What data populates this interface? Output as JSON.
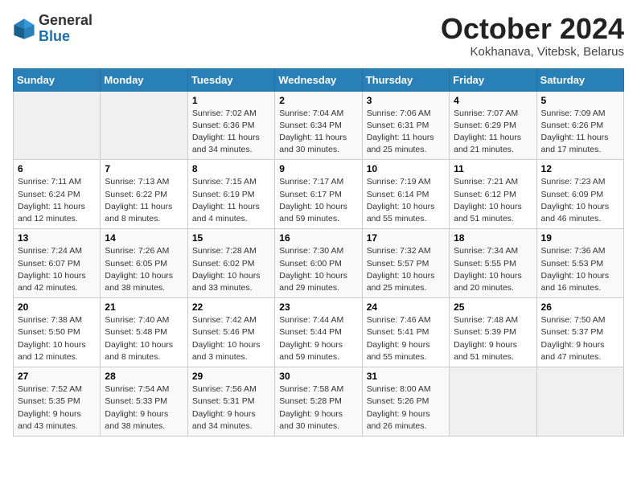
{
  "logo": {
    "general": "General",
    "blue": "Blue"
  },
  "header": {
    "month": "October 2024",
    "location": "Kokhanava, Vitebsk, Belarus"
  },
  "weekdays": [
    "Sunday",
    "Monday",
    "Tuesday",
    "Wednesday",
    "Thursday",
    "Friday",
    "Saturday"
  ],
  "weeks": [
    [
      {
        "day": "",
        "info": ""
      },
      {
        "day": "",
        "info": ""
      },
      {
        "day": "1",
        "info": "Sunrise: 7:02 AM\nSunset: 6:36 PM\nDaylight: 11 hours\nand 34 minutes."
      },
      {
        "day": "2",
        "info": "Sunrise: 7:04 AM\nSunset: 6:34 PM\nDaylight: 11 hours\nand 30 minutes."
      },
      {
        "day": "3",
        "info": "Sunrise: 7:06 AM\nSunset: 6:31 PM\nDaylight: 11 hours\nand 25 minutes."
      },
      {
        "day": "4",
        "info": "Sunrise: 7:07 AM\nSunset: 6:29 PM\nDaylight: 11 hours\nand 21 minutes."
      },
      {
        "day": "5",
        "info": "Sunrise: 7:09 AM\nSunset: 6:26 PM\nDaylight: 11 hours\nand 17 minutes."
      }
    ],
    [
      {
        "day": "6",
        "info": "Sunrise: 7:11 AM\nSunset: 6:24 PM\nDaylight: 11 hours\nand 12 minutes."
      },
      {
        "day": "7",
        "info": "Sunrise: 7:13 AM\nSunset: 6:22 PM\nDaylight: 11 hours\nand 8 minutes."
      },
      {
        "day": "8",
        "info": "Sunrise: 7:15 AM\nSunset: 6:19 PM\nDaylight: 11 hours\nand 4 minutes."
      },
      {
        "day": "9",
        "info": "Sunrise: 7:17 AM\nSunset: 6:17 PM\nDaylight: 10 hours\nand 59 minutes."
      },
      {
        "day": "10",
        "info": "Sunrise: 7:19 AM\nSunset: 6:14 PM\nDaylight: 10 hours\nand 55 minutes."
      },
      {
        "day": "11",
        "info": "Sunrise: 7:21 AM\nSunset: 6:12 PM\nDaylight: 10 hours\nand 51 minutes."
      },
      {
        "day": "12",
        "info": "Sunrise: 7:23 AM\nSunset: 6:09 PM\nDaylight: 10 hours\nand 46 minutes."
      }
    ],
    [
      {
        "day": "13",
        "info": "Sunrise: 7:24 AM\nSunset: 6:07 PM\nDaylight: 10 hours\nand 42 minutes."
      },
      {
        "day": "14",
        "info": "Sunrise: 7:26 AM\nSunset: 6:05 PM\nDaylight: 10 hours\nand 38 minutes."
      },
      {
        "day": "15",
        "info": "Sunrise: 7:28 AM\nSunset: 6:02 PM\nDaylight: 10 hours\nand 33 minutes."
      },
      {
        "day": "16",
        "info": "Sunrise: 7:30 AM\nSunset: 6:00 PM\nDaylight: 10 hours\nand 29 minutes."
      },
      {
        "day": "17",
        "info": "Sunrise: 7:32 AM\nSunset: 5:57 PM\nDaylight: 10 hours\nand 25 minutes."
      },
      {
        "day": "18",
        "info": "Sunrise: 7:34 AM\nSunset: 5:55 PM\nDaylight: 10 hours\nand 20 minutes."
      },
      {
        "day": "19",
        "info": "Sunrise: 7:36 AM\nSunset: 5:53 PM\nDaylight: 10 hours\nand 16 minutes."
      }
    ],
    [
      {
        "day": "20",
        "info": "Sunrise: 7:38 AM\nSunset: 5:50 PM\nDaylight: 10 hours\nand 12 minutes."
      },
      {
        "day": "21",
        "info": "Sunrise: 7:40 AM\nSunset: 5:48 PM\nDaylight: 10 hours\nand 8 minutes."
      },
      {
        "day": "22",
        "info": "Sunrise: 7:42 AM\nSunset: 5:46 PM\nDaylight: 10 hours\nand 3 minutes."
      },
      {
        "day": "23",
        "info": "Sunrise: 7:44 AM\nSunset: 5:44 PM\nDaylight: 9 hours\nand 59 minutes."
      },
      {
        "day": "24",
        "info": "Sunrise: 7:46 AM\nSunset: 5:41 PM\nDaylight: 9 hours\nand 55 minutes."
      },
      {
        "day": "25",
        "info": "Sunrise: 7:48 AM\nSunset: 5:39 PM\nDaylight: 9 hours\nand 51 minutes."
      },
      {
        "day": "26",
        "info": "Sunrise: 7:50 AM\nSunset: 5:37 PM\nDaylight: 9 hours\nand 47 minutes."
      }
    ],
    [
      {
        "day": "27",
        "info": "Sunrise: 7:52 AM\nSunset: 5:35 PM\nDaylight: 9 hours\nand 43 minutes."
      },
      {
        "day": "28",
        "info": "Sunrise: 7:54 AM\nSunset: 5:33 PM\nDaylight: 9 hours\nand 38 minutes."
      },
      {
        "day": "29",
        "info": "Sunrise: 7:56 AM\nSunset: 5:31 PM\nDaylight: 9 hours\nand 34 minutes."
      },
      {
        "day": "30",
        "info": "Sunrise: 7:58 AM\nSunset: 5:28 PM\nDaylight: 9 hours\nand 30 minutes."
      },
      {
        "day": "31",
        "info": "Sunrise: 8:00 AM\nSunset: 5:26 PM\nDaylight: 9 hours\nand 26 minutes."
      },
      {
        "day": "",
        "info": ""
      },
      {
        "day": "",
        "info": ""
      }
    ]
  ]
}
